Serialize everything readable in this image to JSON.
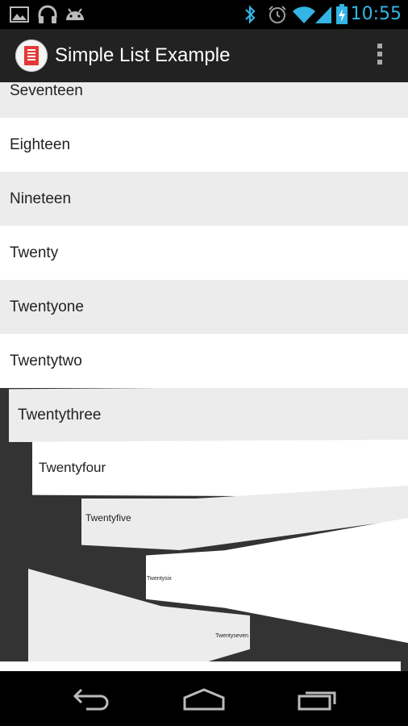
{
  "status_bar": {
    "time": "10:55",
    "icons": [
      "image-icon",
      "headphones-icon",
      "android-icon",
      "bluetooth-icon",
      "alarm-icon",
      "wifi-icon",
      "signal-icon",
      "battery-charging-icon"
    ],
    "accent_color": "#33b5e5"
  },
  "action_bar": {
    "title": "Simple List Example",
    "overflow_icon": "overflow-menu-icon"
  },
  "list": {
    "items": [
      "Seventeen",
      "Eighteen",
      "Nineteen",
      "Twenty",
      "Twentyone",
      "Twentytwo",
      "Twentythree",
      "Twentyfour",
      "Twentyfive",
      "Twentysix",
      "Twentyseven"
    ]
  },
  "nav_bar": {
    "back_icon": "back-icon",
    "home_icon": "home-icon",
    "recents_icon": "recents-icon"
  }
}
